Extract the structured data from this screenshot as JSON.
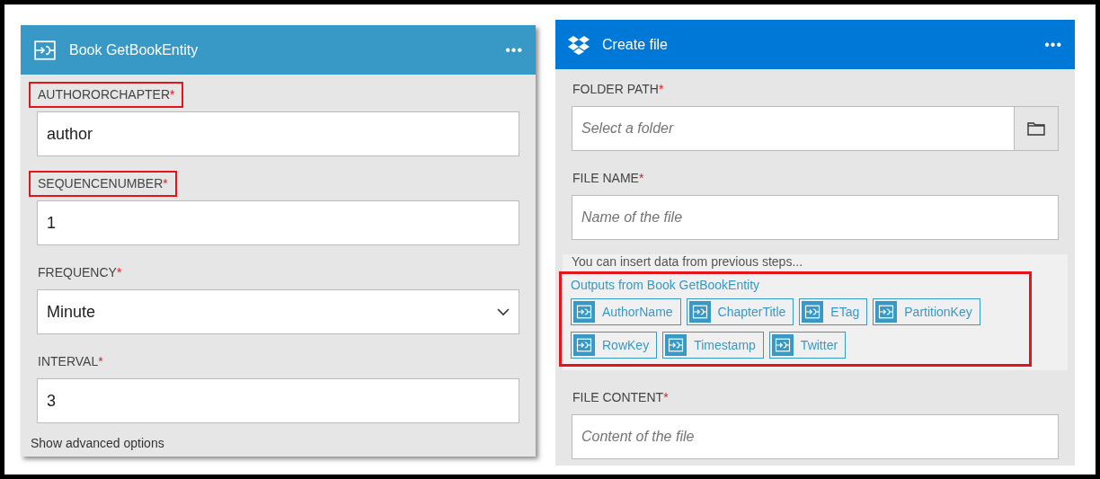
{
  "cards": [
    {
      "kind": "connector",
      "title": "Book GetBookEntity",
      "menu": "•••",
      "fields": [
        {
          "kind": "text",
          "label": "AUTHORORCHAPTER",
          "required_mark": "*",
          "highlighted": true,
          "value": "author"
        },
        {
          "kind": "text",
          "label": "SEQUENCENUMBER",
          "required_mark": "*",
          "highlighted": true,
          "value": "1"
        },
        {
          "kind": "select",
          "label": "FREQUENCY",
          "required_mark": "*",
          "highlighted": false,
          "value": "Minute"
        },
        {
          "kind": "text",
          "label": "INTERVAL",
          "required_mark": "*",
          "highlighted": false,
          "value": "3"
        }
      ],
      "footer_link": "Show advanced options"
    },
    {
      "kind": "dropbox",
      "title": "Create file",
      "menu": "•••",
      "fields": [
        {
          "kind": "folder",
          "label": "FOLDER PATH",
          "required_mark": "*",
          "highlighted": false,
          "placeholder": "Select a folder"
        },
        {
          "kind": "text",
          "label": "FILE NAME",
          "required_mark": "*",
          "highlighted": false,
          "placeholder": "Name of the file"
        },
        {
          "kind": "tokens",
          "hint": "You can insert data from previous steps...",
          "group_title": "Outputs from Book GetBookEntity",
          "highlighted": true,
          "tokens": [
            "AuthorName",
            "ChapterTitle",
            "ETag",
            "PartitionKey",
            "RowKey",
            "Timestamp",
            "Twitter"
          ]
        },
        {
          "kind": "text",
          "label": "FILE CONTENT",
          "required_mark": "*",
          "highlighted": false,
          "placeholder": "Content of the file"
        }
      ]
    }
  ]
}
